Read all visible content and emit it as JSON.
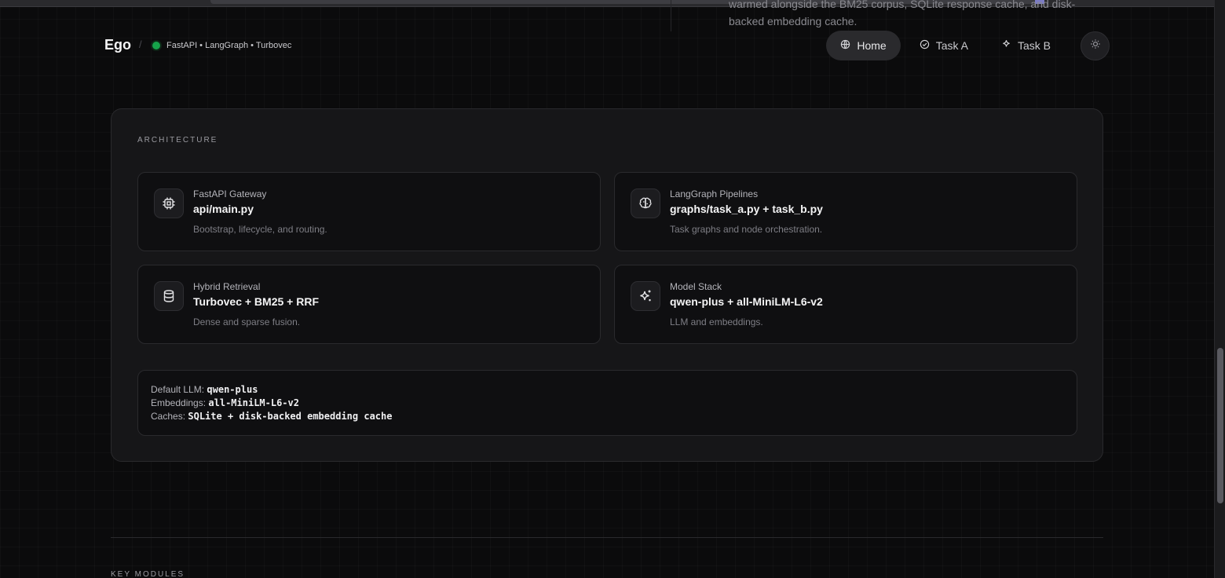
{
  "background": {
    "snippet": "warmed alongside the BM25 corpus, SQLite response cache, and disk-backed embedding cache."
  },
  "header": {
    "brand": "Ego",
    "separator": "/",
    "stack": "FastAPI • LangGraph • Turbovec",
    "status_color": "#16a34a",
    "nav": [
      {
        "label": "Home",
        "icon": "globe-icon",
        "active": true
      },
      {
        "label": "Task A",
        "icon": "check-circle-icon",
        "active": false
      },
      {
        "label": "Task B",
        "icon": "sparkle-icon",
        "active": false
      }
    ],
    "theme_icon": "sun-icon"
  },
  "architecture": {
    "title": "ARCHITECTURE",
    "cards": [
      {
        "icon": "cpu-icon",
        "label": "FastAPI Gateway",
        "title": "api/main.py",
        "desc": "Bootstrap, lifecycle, and routing."
      },
      {
        "icon": "brain-icon",
        "label": "LangGraph Pipelines",
        "title": "graphs/task_a.py + task_b.py",
        "desc": "Task graphs and node orchestration."
      },
      {
        "icon": "database-icon",
        "label": "Hybrid Retrieval",
        "title": "Turbovec + BM25 + RRF",
        "desc": "Dense and sparse fusion."
      },
      {
        "icon": "sparkles-icon",
        "label": "Model Stack",
        "title": "qwen-plus + all-MiniLM-L6-v2",
        "desc": "LLM and embeddings."
      }
    ],
    "config": {
      "llm_label": "Default LLM:",
      "llm_value": "qwen-plus",
      "emb_label": "Embeddings:",
      "emb_value": "all-MiniLM-L6-v2",
      "cache_label": "Caches:",
      "cache_value": "SQLite + disk-backed embedding cache"
    }
  },
  "next_section": {
    "title": "KEY MODULES"
  }
}
